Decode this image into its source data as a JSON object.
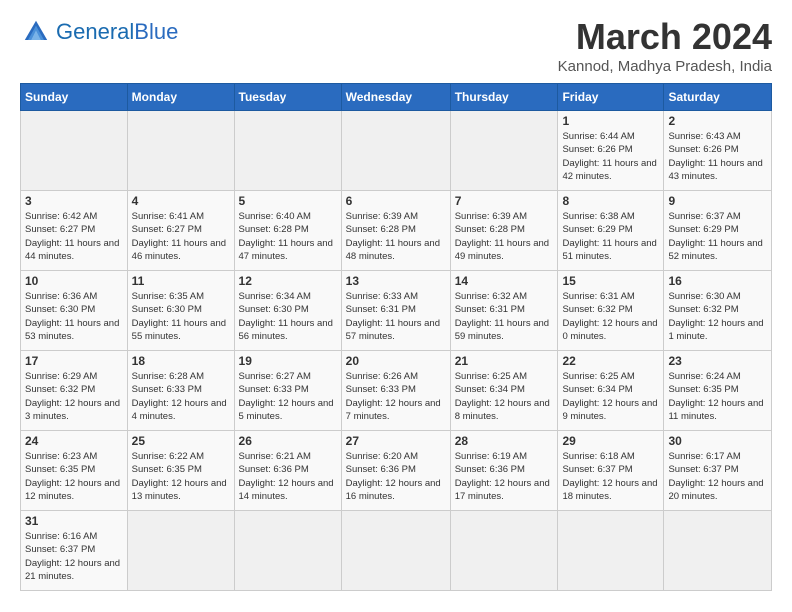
{
  "header": {
    "logo_text_normal": "General",
    "logo_text_colored": "Blue",
    "month_title": "March 2024",
    "subtitle": "Kannod, Madhya Pradesh, India"
  },
  "days_of_week": [
    "Sunday",
    "Monday",
    "Tuesday",
    "Wednesday",
    "Thursday",
    "Friday",
    "Saturday"
  ],
  "weeks": [
    [
      {
        "day": "",
        "info": ""
      },
      {
        "day": "",
        "info": ""
      },
      {
        "day": "",
        "info": ""
      },
      {
        "day": "",
        "info": ""
      },
      {
        "day": "",
        "info": ""
      },
      {
        "day": "1",
        "info": "Sunrise: 6:44 AM\nSunset: 6:26 PM\nDaylight: 11 hours\nand 42 minutes."
      },
      {
        "day": "2",
        "info": "Sunrise: 6:43 AM\nSunset: 6:26 PM\nDaylight: 11 hours\nand 43 minutes."
      }
    ],
    [
      {
        "day": "3",
        "info": "Sunrise: 6:42 AM\nSunset: 6:27 PM\nDaylight: 11 hours\nand 44 minutes."
      },
      {
        "day": "4",
        "info": "Sunrise: 6:41 AM\nSunset: 6:27 PM\nDaylight: 11 hours\nand 46 minutes."
      },
      {
        "day": "5",
        "info": "Sunrise: 6:40 AM\nSunset: 6:28 PM\nDaylight: 11 hours\nand 47 minutes."
      },
      {
        "day": "6",
        "info": "Sunrise: 6:39 AM\nSunset: 6:28 PM\nDaylight: 11 hours\nand 48 minutes."
      },
      {
        "day": "7",
        "info": "Sunrise: 6:39 AM\nSunset: 6:28 PM\nDaylight: 11 hours\nand 49 minutes."
      },
      {
        "day": "8",
        "info": "Sunrise: 6:38 AM\nSunset: 6:29 PM\nDaylight: 11 hours\nand 51 minutes."
      },
      {
        "day": "9",
        "info": "Sunrise: 6:37 AM\nSunset: 6:29 PM\nDaylight: 11 hours\nand 52 minutes."
      }
    ],
    [
      {
        "day": "10",
        "info": "Sunrise: 6:36 AM\nSunset: 6:30 PM\nDaylight: 11 hours\nand 53 minutes."
      },
      {
        "day": "11",
        "info": "Sunrise: 6:35 AM\nSunset: 6:30 PM\nDaylight: 11 hours\nand 55 minutes."
      },
      {
        "day": "12",
        "info": "Sunrise: 6:34 AM\nSunset: 6:30 PM\nDaylight: 11 hours\nand 56 minutes."
      },
      {
        "day": "13",
        "info": "Sunrise: 6:33 AM\nSunset: 6:31 PM\nDaylight: 11 hours\nand 57 minutes."
      },
      {
        "day": "14",
        "info": "Sunrise: 6:32 AM\nSunset: 6:31 PM\nDaylight: 11 hours\nand 59 minutes."
      },
      {
        "day": "15",
        "info": "Sunrise: 6:31 AM\nSunset: 6:32 PM\nDaylight: 12 hours\nand 0 minutes."
      },
      {
        "day": "16",
        "info": "Sunrise: 6:30 AM\nSunset: 6:32 PM\nDaylight: 12 hours\nand 1 minute."
      }
    ],
    [
      {
        "day": "17",
        "info": "Sunrise: 6:29 AM\nSunset: 6:32 PM\nDaylight: 12 hours\nand 3 minutes."
      },
      {
        "day": "18",
        "info": "Sunrise: 6:28 AM\nSunset: 6:33 PM\nDaylight: 12 hours\nand 4 minutes."
      },
      {
        "day": "19",
        "info": "Sunrise: 6:27 AM\nSunset: 6:33 PM\nDaylight: 12 hours\nand 5 minutes."
      },
      {
        "day": "20",
        "info": "Sunrise: 6:26 AM\nSunset: 6:33 PM\nDaylight: 12 hours\nand 7 minutes."
      },
      {
        "day": "21",
        "info": "Sunrise: 6:25 AM\nSunset: 6:34 PM\nDaylight: 12 hours\nand 8 minutes."
      },
      {
        "day": "22",
        "info": "Sunrise: 6:25 AM\nSunset: 6:34 PM\nDaylight: 12 hours\nand 9 minutes."
      },
      {
        "day": "23",
        "info": "Sunrise: 6:24 AM\nSunset: 6:35 PM\nDaylight: 12 hours\nand 11 minutes."
      }
    ],
    [
      {
        "day": "24",
        "info": "Sunrise: 6:23 AM\nSunset: 6:35 PM\nDaylight: 12 hours\nand 12 minutes."
      },
      {
        "day": "25",
        "info": "Sunrise: 6:22 AM\nSunset: 6:35 PM\nDaylight: 12 hours\nand 13 minutes."
      },
      {
        "day": "26",
        "info": "Sunrise: 6:21 AM\nSunset: 6:36 PM\nDaylight: 12 hours\nand 14 minutes."
      },
      {
        "day": "27",
        "info": "Sunrise: 6:20 AM\nSunset: 6:36 PM\nDaylight: 12 hours\nand 16 minutes."
      },
      {
        "day": "28",
        "info": "Sunrise: 6:19 AM\nSunset: 6:36 PM\nDaylight: 12 hours\nand 17 minutes."
      },
      {
        "day": "29",
        "info": "Sunrise: 6:18 AM\nSunset: 6:37 PM\nDaylight: 12 hours\nand 18 minutes."
      },
      {
        "day": "30",
        "info": "Sunrise: 6:17 AM\nSunset: 6:37 PM\nDaylight: 12 hours\nand 20 minutes."
      }
    ],
    [
      {
        "day": "31",
        "info": "Sunrise: 6:16 AM\nSunset: 6:37 PM\nDaylight: 12 hours\nand 21 minutes."
      },
      {
        "day": "",
        "info": ""
      },
      {
        "day": "",
        "info": ""
      },
      {
        "day": "",
        "info": ""
      },
      {
        "day": "",
        "info": ""
      },
      {
        "day": "",
        "info": ""
      },
      {
        "day": "",
        "info": ""
      }
    ]
  ]
}
